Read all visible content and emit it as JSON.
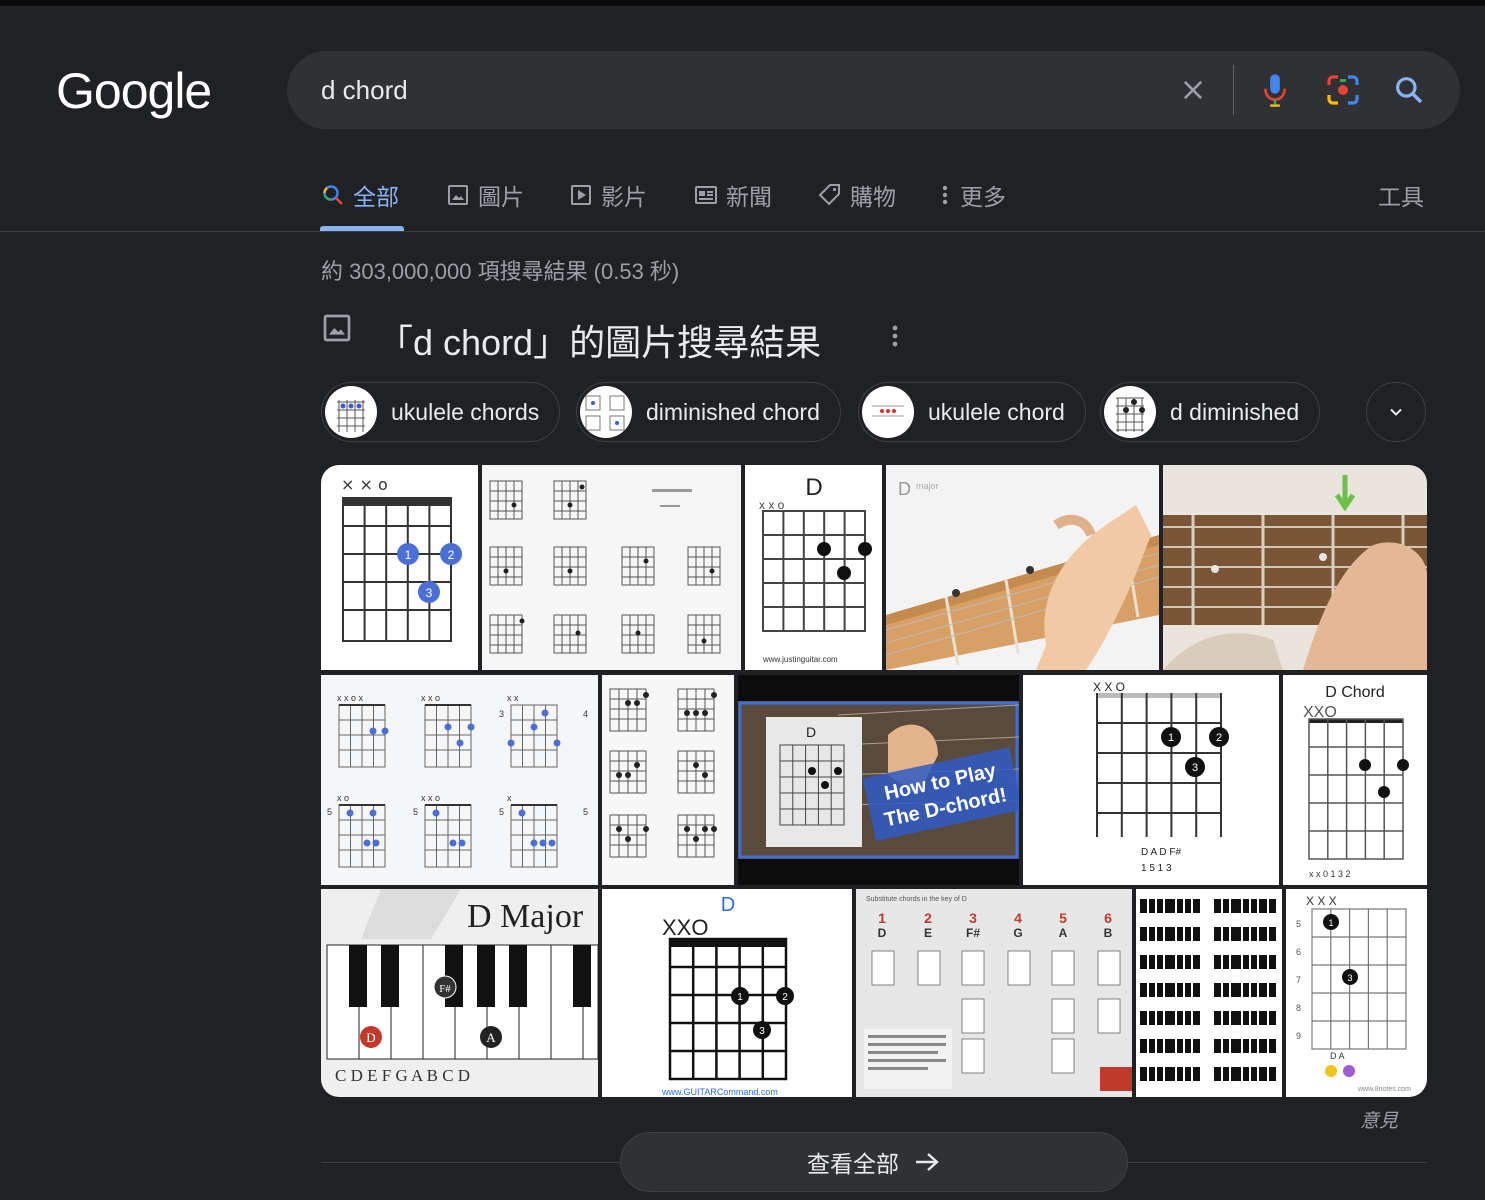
{
  "logo": "Google",
  "search": {
    "query": "d chord"
  },
  "tabs": [
    {
      "label": "全部",
      "icon": "search-icon"
    },
    {
      "label": "圖片",
      "icon": "image-icon"
    },
    {
      "label": "影片",
      "icon": "video-icon"
    },
    {
      "label": "新聞",
      "icon": "news-icon"
    },
    {
      "label": "購物",
      "icon": "tag-icon"
    },
    {
      "label": "更多",
      "icon": "more-vert-icon"
    }
  ],
  "tools_label": "工具",
  "result_stats": "約 303,000,000 項搜尋結果 (0.53 秒)",
  "image_section": {
    "title": "「d chord」的圖片搜尋結果"
  },
  "chips": [
    {
      "label": "ukulele chords"
    },
    {
      "label": "diminished chord"
    },
    {
      "label": "ukulele chord"
    },
    {
      "label": "d diminished"
    }
  ],
  "thumbnails": {
    "t3_label": "D",
    "t3_site": "www.justinguitar.com",
    "t4_label": "D",
    "t4_sub": "major",
    "t8_line1": "How to Play",
    "t8_line2": "The D-chord!",
    "t8_label": "D",
    "t9_muted": "X   X   O",
    "t9_notes": "D    A    D    F#",
    "t9_fingers": "1    5    1    3",
    "t10_title": "D Chord",
    "t10_muted": "XXO",
    "t10_fingers": "x  x  0  1  3  2",
    "t11_title": "D Major",
    "t11_keys": "C  D  E  F  G  A  B  C  D",
    "t12_label": "D",
    "t12_muted": "XXO",
    "t12_site": "www.GUITARCommand.com",
    "t13_header": "Substitute chords in the key of D",
    "t13_nums": [
      "1",
      "2",
      "3",
      "4",
      "5",
      "6"
    ],
    "t13_roots": [
      "D",
      "E",
      "F#",
      "G",
      "A",
      "B"
    ],
    "t15_muted": "X        X  X",
    "t15_notes": "D  A",
    "t15_site": "www.8notes.com"
  },
  "feedback": "意見",
  "see_all": "查看全部",
  "colors": {
    "accent": "#8ab4f8",
    "background": "#202124",
    "surface": "#303134"
  }
}
